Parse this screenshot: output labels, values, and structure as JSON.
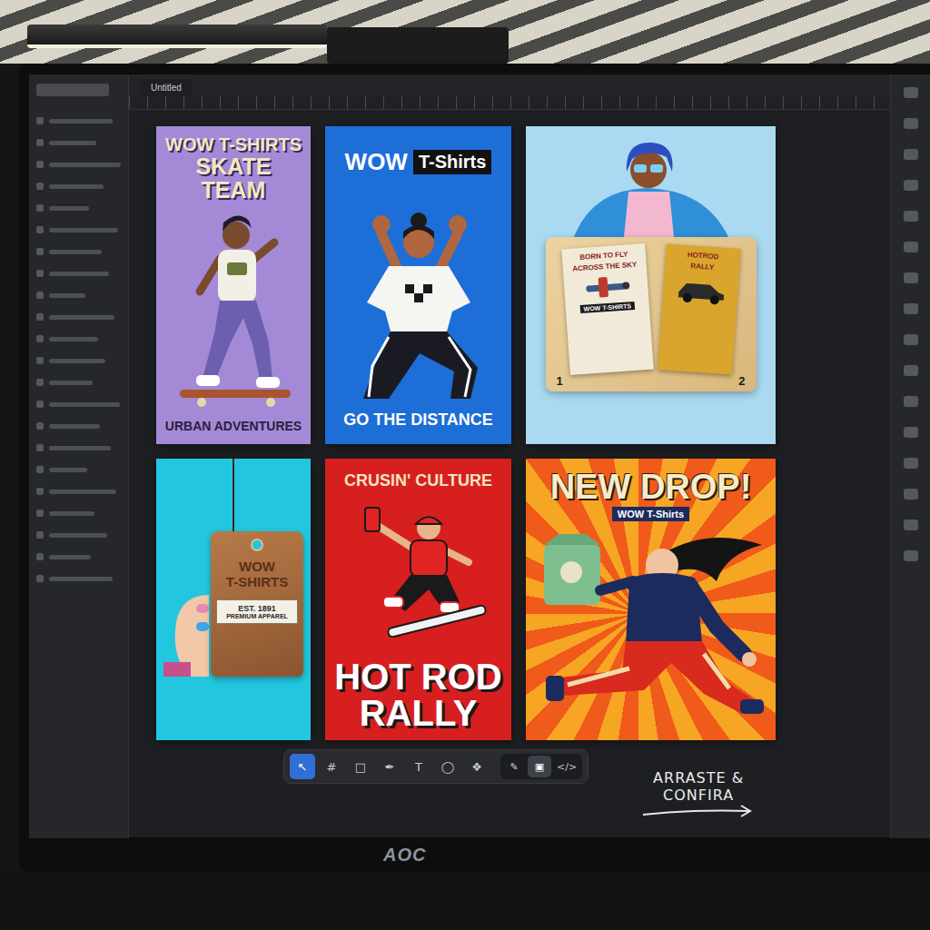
{
  "app": {
    "tab": "Untitled"
  },
  "posters": [
    {
      "kind": "skate-team",
      "color": "#a48ad6",
      "title": [
        "WOW T-SHIRTS",
        "SKATE TEAM"
      ],
      "subtitle": "URBAN ADVENTURES"
    },
    {
      "kind": "go-distance",
      "color": "#1d6ed6",
      "brand": "WOW",
      "badge": "T-Shirts",
      "subtitle": "GO THE DISTANCE"
    },
    {
      "kind": "showcase",
      "color": "#a9daf2",
      "cards": [
        {
          "number": "1",
          "lines": [
            "BORN TO FLY",
            "ACROSS THE SKY"
          ],
          "label": "WOW T-SHIRTS",
          "color": "#f1ead8"
        },
        {
          "number": "2",
          "lines": [
            "HOTROD",
            "RALLY"
          ],
          "color": "#d9a52c"
        }
      ]
    },
    {
      "kind": "tag",
      "color": "#22c6df",
      "tag": [
        "WOW",
        "T-SHIRTS"
      ],
      "label": [
        "EST. 1891",
        "PREMIUM APPAREL"
      ]
    },
    {
      "kind": "hot-rod",
      "color": "#d71f1f",
      "subtitle": "CRUSIN' CULTURE",
      "title": [
        "HOT ROD",
        "RALLY"
      ]
    },
    {
      "kind": "new-drop",
      "color": "#f05a1a",
      "title": "NEW DROP!",
      "badge": "WOW T-Shirts"
    }
  ],
  "toolbar": {
    "tools": [
      {
        "label": "↖",
        "selected": true
      },
      {
        "label": "#",
        "selected": false
      },
      {
        "label": "□",
        "selected": false
      },
      {
        "label": "✒",
        "selected": false
      },
      {
        "label": "T",
        "selected": false
      },
      {
        "label": "◯",
        "selected": false
      },
      {
        "label": "❖",
        "selected": false
      }
    ],
    "modes": [
      {
        "label": "✎",
        "selected": false
      },
      {
        "label": "▣",
        "selected": true
      },
      {
        "label": "</>",
        "selected": false
      }
    ]
  },
  "note": {
    "lines": [
      "ARRASTE &",
      "CONFIRA"
    ]
  },
  "monitor": {
    "brand": "AOC"
  }
}
